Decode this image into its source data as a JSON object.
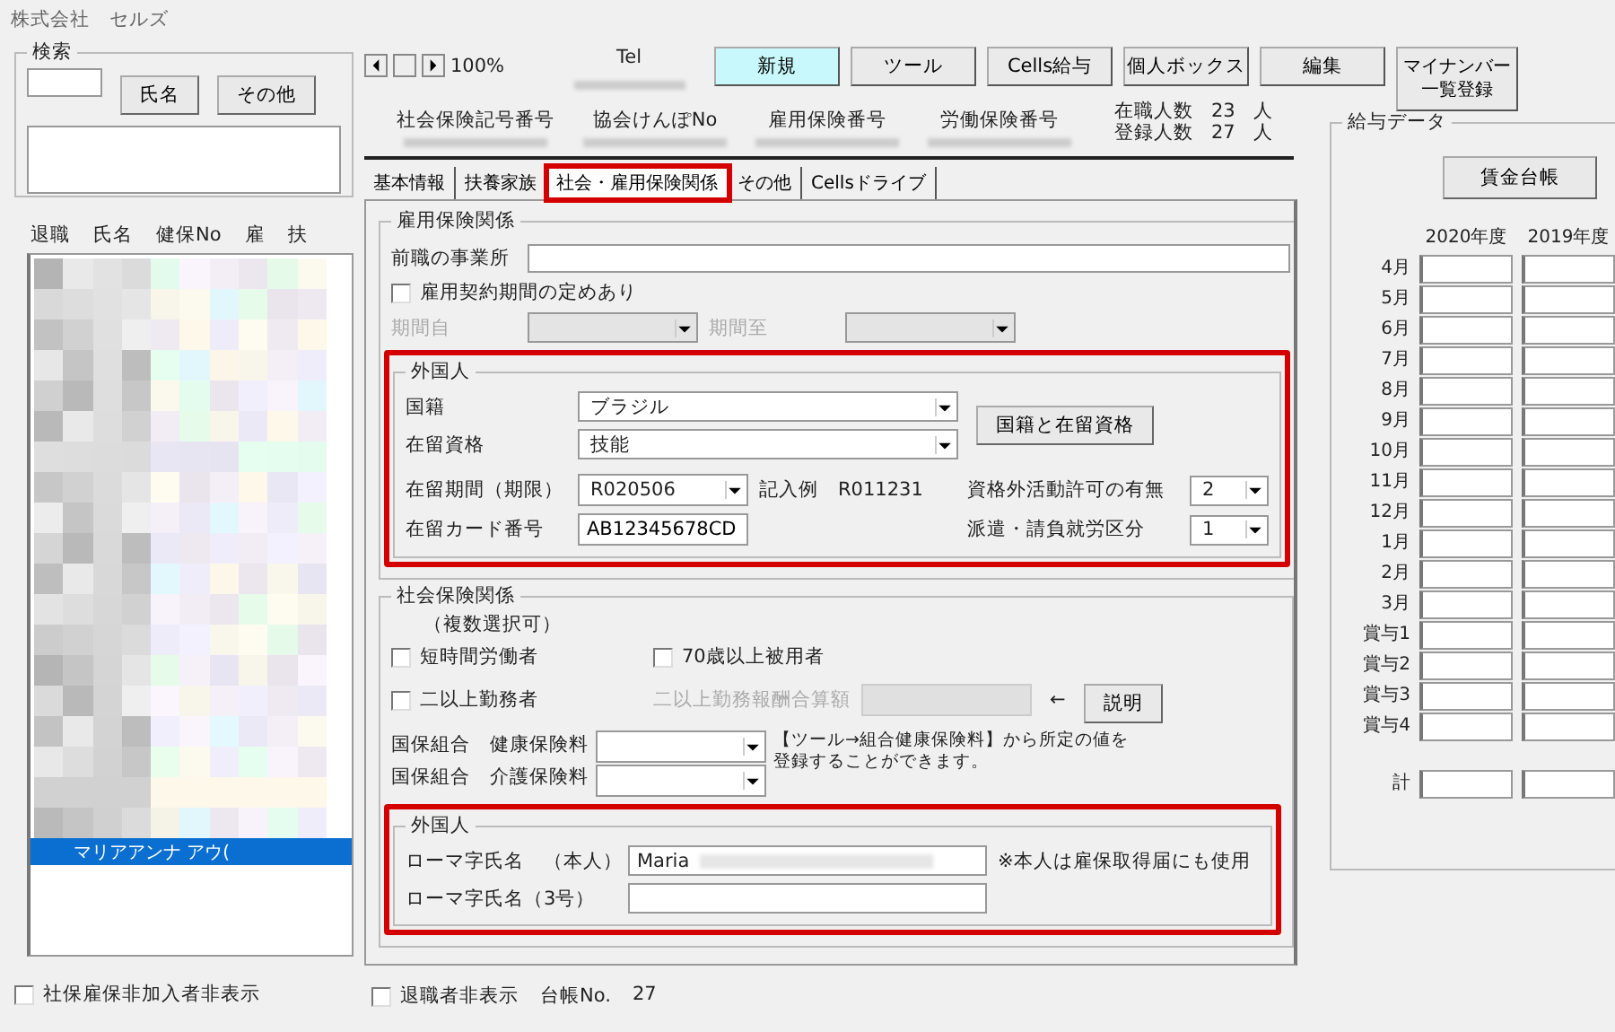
{
  "window": {
    "title": "株式会社　セルズ"
  },
  "search": {
    "title": "検索",
    "buttons": [
      "氏名",
      "その他"
    ]
  },
  "employee_list": {
    "columns": [
      "退職",
      "氏名",
      "健保No",
      "雇",
      "扶"
    ],
    "rows": [
      {
        "name": "マリアアンナ アウ(",
        "selected": true
      }
    ]
  },
  "nav": {
    "zoom": "100%",
    "tel_label": "Tel"
  },
  "toolbar": [
    {
      "label": "新規",
      "selected": true
    },
    {
      "label": "ツール",
      "selected": false
    },
    {
      "label": "Cells給与",
      "selected": false
    },
    {
      "label": "個人ボックス",
      "selected": false
    },
    {
      "label": "編集",
      "selected": false
    },
    {
      "label": "マイナンバー一覧登録",
      "selected": false
    }
  ],
  "header_fields": [
    {
      "label": "社会保険記号番号"
    },
    {
      "label": "協会けんぽNo"
    },
    {
      "label": "雇用保険番号"
    },
    {
      "label": "労働保険番号"
    }
  ],
  "counts": [
    {
      "label": "在職人数",
      "value": "23",
      "unit": "人"
    },
    {
      "label": "登録人数",
      "value": "27",
      "unit": "人"
    }
  ],
  "tabs": [
    {
      "label": "基本情報",
      "selected": false,
      "highlighted": false
    },
    {
      "label": "扶養家族",
      "selected": false,
      "highlighted": false
    },
    {
      "label": "社会・雇用保険関係",
      "selected": true,
      "highlighted": true
    },
    {
      "label": "その他",
      "selected": false,
      "highlighted": false
    },
    {
      "label": "Cellsドライブ",
      "selected": false,
      "highlighted": false
    }
  ],
  "employment_insurance": {
    "title": "雇用保険関係",
    "previous_employer_label": "前職の事業所",
    "fixed_term": {
      "label": "雇用契約期間の定めあり",
      "checked": false
    },
    "period_from": {
      "label": "期間自",
      "disabled": true
    },
    "period_to": {
      "label": "期間至",
      "disabled": true
    }
  },
  "foreign_worker": {
    "title": "外国人",
    "highlighted": true,
    "nationality": {
      "label": "国籍",
      "value": "ブラジル"
    },
    "status": {
      "label": "在留資格",
      "value": "技能"
    },
    "period": {
      "label": "在留期間（期限）",
      "value": "R020506"
    },
    "example": "記入例　R011231",
    "card": {
      "label": "在留カード番号",
      "value": "AB12345678CD"
    },
    "button": "国籍と在留資格",
    "permit": {
      "label": "資格外活動許可の有無",
      "value": "2"
    },
    "dispatch": {
      "label": "派遣・請負就労区分",
      "value": "1"
    }
  },
  "social_insurance": {
    "title": "社会保険関係",
    "note": "（複数選択可）",
    "checkboxes": [
      {
        "label": "短時間労働者",
        "checked": false
      },
      {
        "label": "70歳以上被用者",
        "checked": false
      },
      {
        "label": "二以上勤務者",
        "checked": false
      }
    ],
    "multi_office": {
      "label": "二以上勤務報酬合算額",
      "disabled": true
    },
    "arrow": "←",
    "explain_button": "説明",
    "union_health": {
      "label": "国保組合　健康保険料"
    },
    "union_care": {
      "label": "国保組合　介護保険料"
    },
    "hint": "【ツール→組合健康保険料】から所定の値を登録することができます。"
  },
  "foreign_names": {
    "title": "外国人",
    "highlighted": true,
    "fields": [
      {
        "label": "ローマ字氏名　（本人）",
        "value": "Maria"
      },
      {
        "label": "ローマ字氏名（3号）"
      }
    ],
    "note": "※本人は雇保取得届にも使用"
  },
  "salary": {
    "title": "給与データ",
    "ledger_button": "賃金台帳",
    "years": [
      "2020年度",
      "2019年度"
    ],
    "rows": [
      "4月",
      "5月",
      "6月",
      "7月",
      "8月",
      "9月",
      "10月",
      "11月",
      "12月",
      "1月",
      "2月",
      "3月",
      "賞与1",
      "賞与2",
      "賞与3",
      "賞与4"
    ],
    "total_label": "計"
  },
  "footer": {
    "hide_non_enrolled": {
      "label": "社保雇保非加入者非表示",
      "checked": false
    },
    "hide_retired": {
      "label": "退職者非表示",
      "checked": false
    },
    "ledger_no_label": "台帳No.",
    "ledger_no": "27"
  }
}
